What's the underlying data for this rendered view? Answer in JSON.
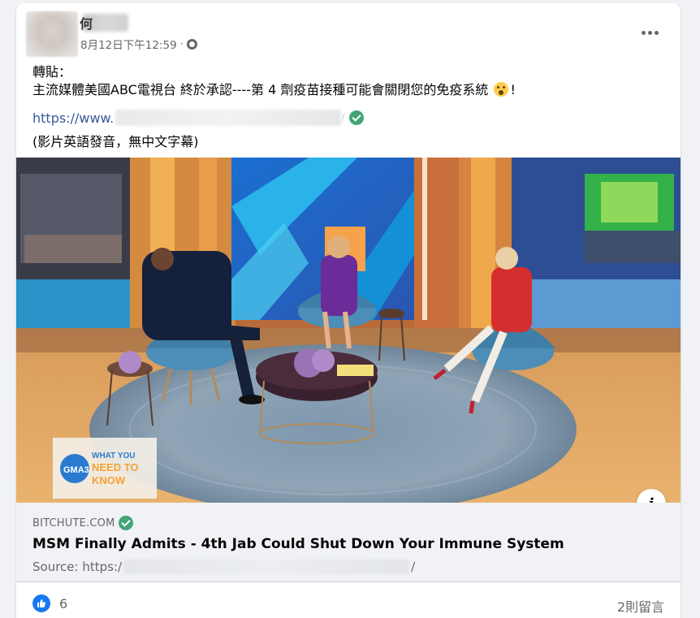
{
  "post": {
    "author_visible_char": "何",
    "timestamp": "8月12日下午12:59",
    "separator": "·",
    "audience_icon": "globe-icon",
    "more_icon": "more-dots-icon",
    "body_line1": "轉貼：",
    "body_line2_prefix": "主流媒體美國ABC電視台 終於承認----第 4 劑疫苗接種可能會關閉您的免疫系統 ",
    "body_line2_suffix": "!",
    "emoji_icon": "astonished-face-emoji-icon",
    "link_prefix": "https://www.",
    "link_suffix": "/",
    "note": "(影片英語發音，無中文字幕)",
    "video": {
      "badge_text_1": "GMA3",
      "badge_text_2": "WHAT YOU",
      "badge_text_3": "NEED TO",
      "badge_text_4": "KNOW"
    },
    "link_card": {
      "domain": "BITCHUTE.COM",
      "title": "MSM Finally Admits - 4th Jab Could Shut Down Your Immune System",
      "source_prefix": "Source: https:/",
      "source_suffix": "/"
    },
    "footer": {
      "likes": "6",
      "comments": "2則留言"
    }
  },
  "colors": {
    "link": "#385898",
    "verified": "#42a577",
    "like": "#1877f2",
    "secondary_text": "#65676b"
  }
}
